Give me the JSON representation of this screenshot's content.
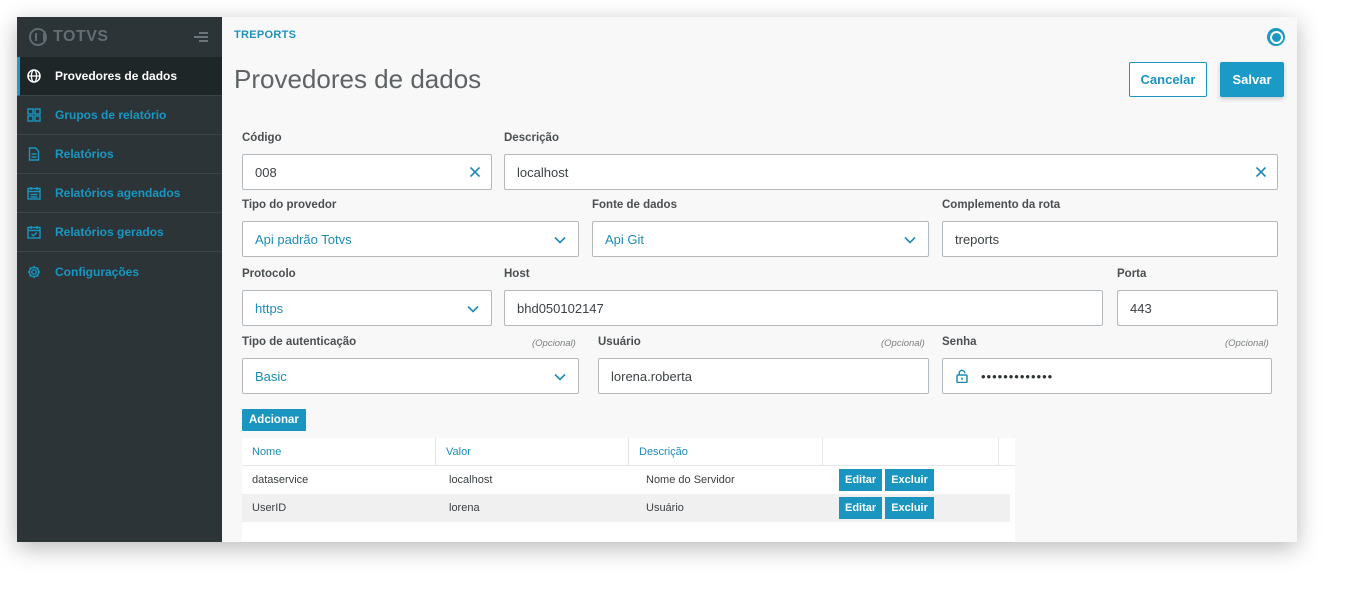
{
  "sidebar": {
    "brand": "TOTVS",
    "items": [
      {
        "label": "Provedores de dados",
        "icon": "globe-icon",
        "active": true
      },
      {
        "label": "Grupos de relatório",
        "icon": "grid-icon",
        "active": false
      },
      {
        "label": "Relatórios",
        "icon": "document-icon",
        "active": false
      },
      {
        "label": "Relatórios agendados",
        "icon": "calendar-icon",
        "active": false
      },
      {
        "label": "Relatórios gerados",
        "icon": "calendar-check-icon",
        "active": false
      },
      {
        "label": "Configurações",
        "icon": "gear-icon",
        "active": false
      }
    ]
  },
  "header": {
    "breadcrumb": "TREPORTS",
    "title": "Provedores de dados",
    "cancel_label": "Cancelar",
    "save_label": "Salvar"
  },
  "form": {
    "codigo": {
      "label": "Código",
      "value": "008"
    },
    "descricao": {
      "label": "Descrição",
      "value": "localhost"
    },
    "tipo_provedor": {
      "label": "Tipo do provedor",
      "value": "Api padrão Totvs"
    },
    "fonte_dados": {
      "label": "Fonte de dados",
      "value": "Api Git"
    },
    "complemento_rota": {
      "label": "Complemento da rota",
      "value": "treports"
    },
    "protocolo": {
      "label": "Protocolo",
      "value": "https"
    },
    "host": {
      "label": "Host",
      "value": "bhd050102147"
    },
    "porta": {
      "label": "Porta",
      "value": "443"
    },
    "tipo_autenticacao": {
      "label": "Tipo de autenticação",
      "optional": "(Opcional)",
      "value": "Basic"
    },
    "usuario": {
      "label": "Usuário",
      "optional": "(Opcional)",
      "value": "lorena.roberta"
    },
    "senha": {
      "label": "Senha",
      "optional": "(Opcional)",
      "value": "•••••••••••••"
    }
  },
  "params_table": {
    "add_label": "Adcionar",
    "columns": [
      "Nome",
      "Valor",
      "Descrição"
    ],
    "rows": [
      {
        "nome": "dataservice",
        "valor": "localhost",
        "descricao": "Nome do Servidor"
      },
      {
        "nome": "UserID",
        "valor": "lorena",
        "descricao": "Usuário"
      }
    ],
    "edit_label": "Editar",
    "delete_label": "Excluir"
  },
  "colors": {
    "accent": "#1a9ac6",
    "sidebar_bg": "#2c3437",
    "sidebar_active_bg": "#1f2628"
  }
}
